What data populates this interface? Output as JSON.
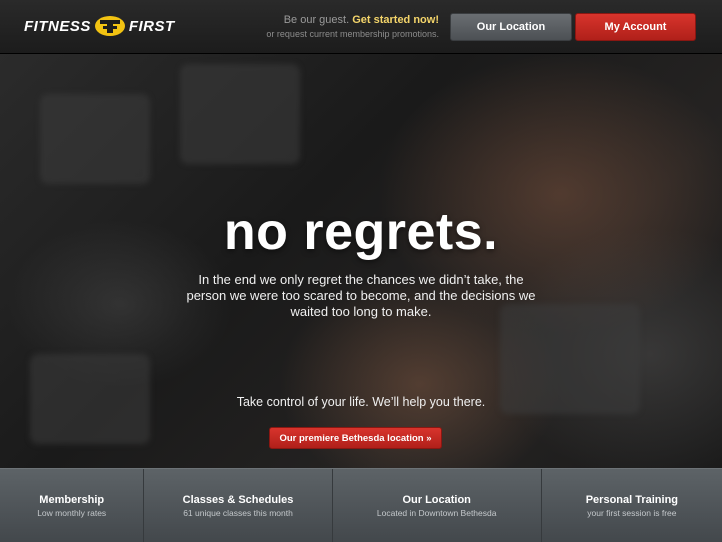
{
  "header": {
    "logo_text_left": "FITNESS",
    "logo_text_right": "FIRST",
    "guest_prefix": "Be our guest.",
    "guest_cta": "Get started now!",
    "guest_sub": "or request current membership promotions.",
    "location_button": "Our Location",
    "account_button": "My Account"
  },
  "hero": {
    "headline": "no regrets.",
    "quote": "In the end we only regret the chances we didn’t take, the person we were too scared to become, and the decisions we waited too long to make.",
    "tagline": "Take control of your life. We’ll help you there.",
    "cta_button": "Our premiere Bethesda location »"
  },
  "features": [
    {
      "title": "Membership",
      "subtitle": "Low monthly rates"
    },
    {
      "title": "Classes & Schedules",
      "subtitle": "61 unique classes this month"
    },
    {
      "title": "Our Location",
      "subtitle": "Located in Downtown Bethesda"
    },
    {
      "title": "Personal Training",
      "subtitle": "your first session is free"
    }
  ],
  "colors": {
    "accent_red": "#c62a22",
    "cta_yellow": "#f3d46a",
    "logo_yellow": "#f2c312"
  }
}
